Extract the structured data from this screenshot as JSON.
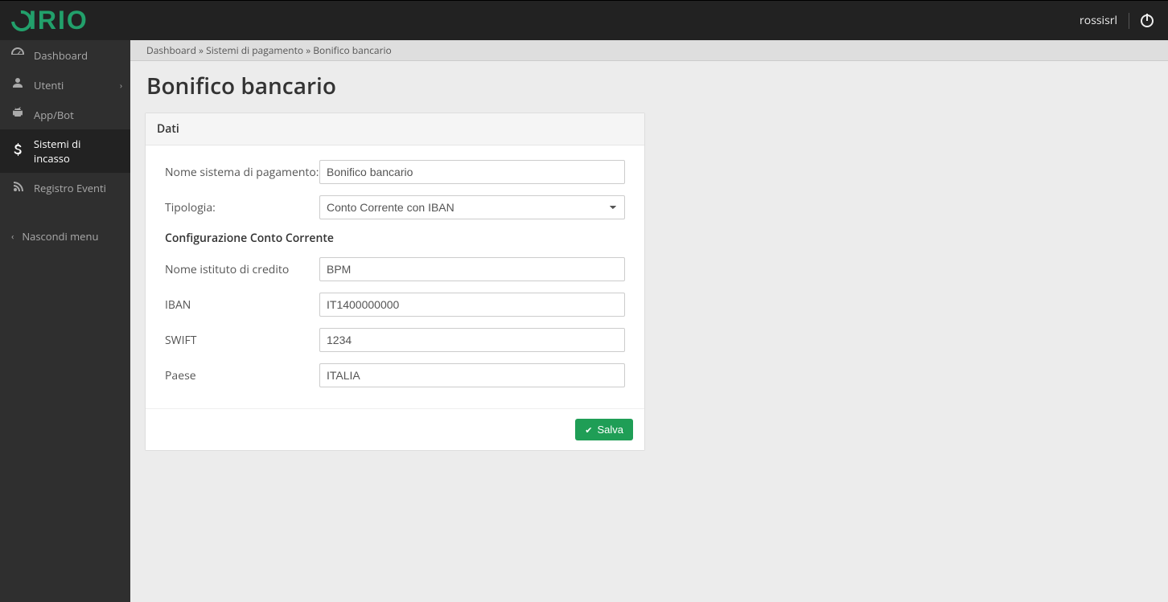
{
  "brand": "SIRIO",
  "username": "rossisrl",
  "sidebar": {
    "items": [
      {
        "label": "Dashboard"
      },
      {
        "label": "Utenti"
      },
      {
        "label": "App/Bot"
      },
      {
        "label": "Sistemi di incasso"
      },
      {
        "label": "Registro Eventi"
      }
    ],
    "hide_menu": "Nascondi menu"
  },
  "breadcrumb": {
    "a": "Dashboard",
    "b": "Sistemi di pagamento",
    "c": "Bonifico bancario",
    "sep": " » "
  },
  "page_title": "Bonifico bancario",
  "panel": {
    "heading": "Dati",
    "labels": {
      "nome_sistema": "Nome sistema di pagamento:",
      "tipologia": "Tipologia:",
      "config": "Configurazione Conto Corrente",
      "istituto": "Nome istituto di credito",
      "iban": "IBAN",
      "swift": "SWIFT",
      "paese": "Paese"
    },
    "values": {
      "nome_sistema": "Bonifico bancario",
      "tipologia": "Conto Corrente con IBAN",
      "istituto": "BPM",
      "iban": "IT1400000000",
      "swift": "1234",
      "paese": "ITALIA"
    },
    "save": "Salva"
  }
}
